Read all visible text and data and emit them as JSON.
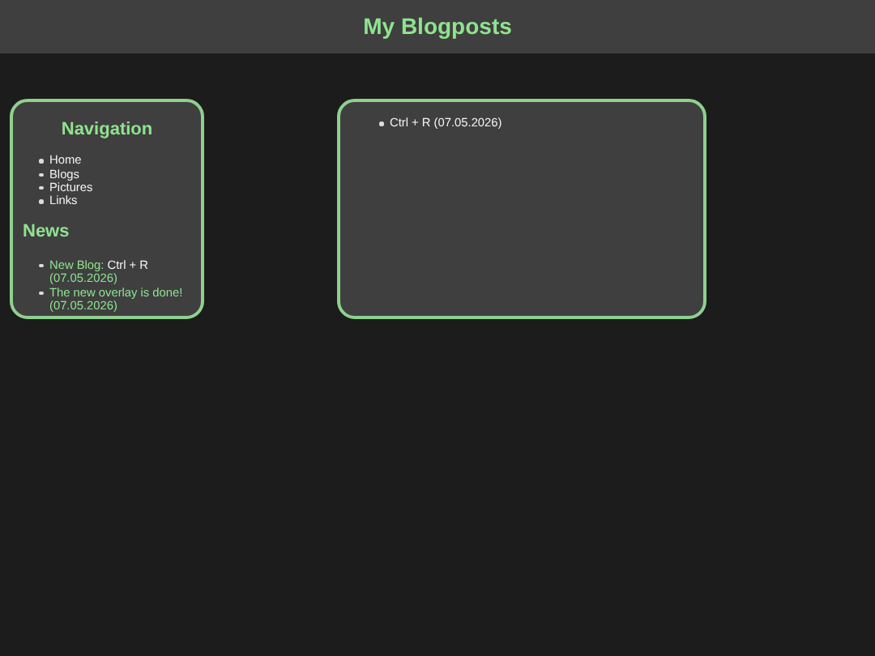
{
  "header": {
    "title": "My Blogposts"
  },
  "sidebar": {
    "navigation": {
      "title": "Navigation",
      "items": [
        "Home",
        "Blogs",
        "Pictures",
        "Links"
      ]
    },
    "news": {
      "title": "News",
      "items": [
        {
          "prefix": "New Blog: ",
          "link": "Ctrl + R",
          "date": "(07.05.2026)"
        },
        {
          "prefix": "The new overlay is done!",
          "date": "(07.05.2026)"
        }
      ]
    }
  },
  "posts": [
    "Ctrl + R (07.05.2026)"
  ]
}
